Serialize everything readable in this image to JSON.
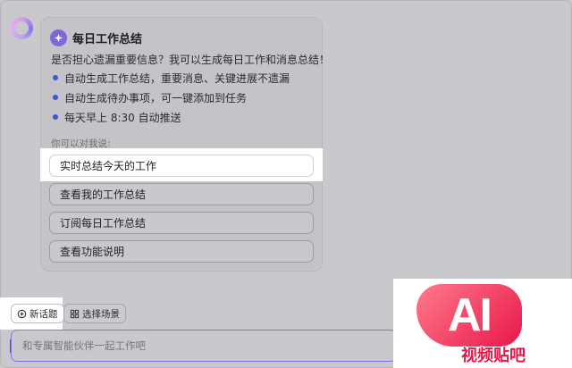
{
  "card": {
    "title": "每日工作总结",
    "intro": "是否担心遗漏重要信息？我可以生成每日工作和消息总结！",
    "features": [
      "自动生成工作总结，重要消息、关键进展不遗漏",
      "自动生成待办事项，可一键添加到任务",
      "每天早上 8:30 自动推送"
    ],
    "hint_label": "你可以对我说:",
    "suggestions": [
      "实时总结今天的工作",
      "查看我的工作总结",
      "订阅每日工作总结",
      "查看功能说明"
    ]
  },
  "toolbar": {
    "new_topic": "新话题",
    "choose_scene": "选择场景"
  },
  "composer": {
    "placeholder": "和专属智能伙伴一起工作吧"
  },
  "watermark": {
    "logo_text": "AI",
    "label": "视频贴吧"
  },
  "colors": {
    "accent": "#8f6fe4",
    "bullet": "#3f58c8",
    "app_icon": "#7f68d6",
    "watermark": "#e8174a"
  },
  "icons": {
    "assistant": "assistant-ring-icon",
    "app": "sparkle-badge-icon",
    "new_topic": "chat-plus-icon",
    "scene": "grid-icon"
  }
}
